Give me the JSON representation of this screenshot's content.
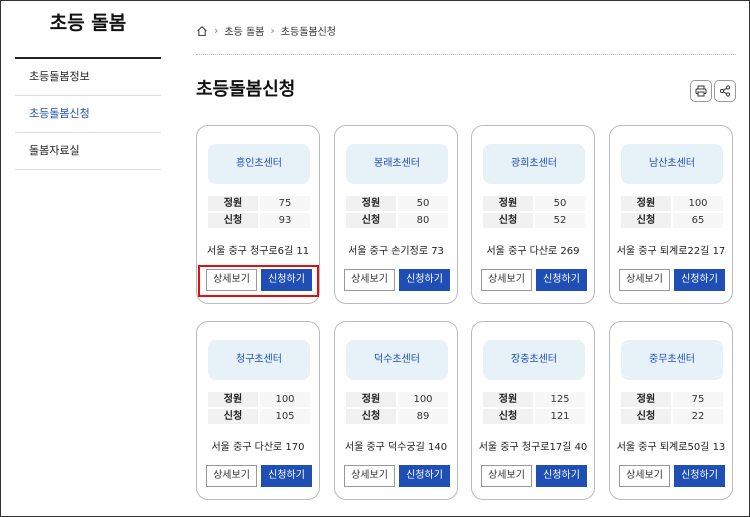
{
  "sidebar": {
    "title": "초등 돌봄",
    "items": [
      {
        "label": "초등돌봄정보"
      },
      {
        "label": "초등돌봄신청"
      },
      {
        "label": "돌봄자료실"
      }
    ]
  },
  "breadcrumb": {
    "items": [
      "초등 돌봄",
      "초등돌봄신청"
    ]
  },
  "page": {
    "title": "초등돌봄신청"
  },
  "labels": {
    "capacity": "정원",
    "applied": "신청",
    "detail": "상세보기",
    "apply": "신청하기"
  },
  "centers": [
    {
      "name": "흥인초센터",
      "capacity": "75",
      "applied": "93",
      "address": "서울 중구 청구로6길 11"
    },
    {
      "name": "봉래초센터",
      "capacity": "50",
      "applied": "80",
      "address": "서울 중구 손기정로 73"
    },
    {
      "name": "광희초센터",
      "capacity": "50",
      "applied": "52",
      "address": "서울 중구 다산로 269"
    },
    {
      "name": "남산초센터",
      "capacity": "100",
      "applied": "65",
      "address": "서울 중구 퇴계로22길 17"
    },
    {
      "name": "청구초센터",
      "capacity": "100",
      "applied": "105",
      "address": "서울 중구 다산로 170"
    },
    {
      "name": "덕수초센터",
      "capacity": "100",
      "applied": "89",
      "address": "서울 중구 덕수궁길 140"
    },
    {
      "name": "장충초센터",
      "capacity": "125",
      "applied": "121",
      "address": "서울 중구 청구로17길 40"
    },
    {
      "name": "중무초센터",
      "capacity": "75",
      "applied": "22",
      "address": "서울 중구 퇴계로50길 13"
    }
  ],
  "colors": {
    "accent": "#1f4fb5",
    "card_head_bg": "#e6f1f8",
    "highlight": "#e01010"
  }
}
